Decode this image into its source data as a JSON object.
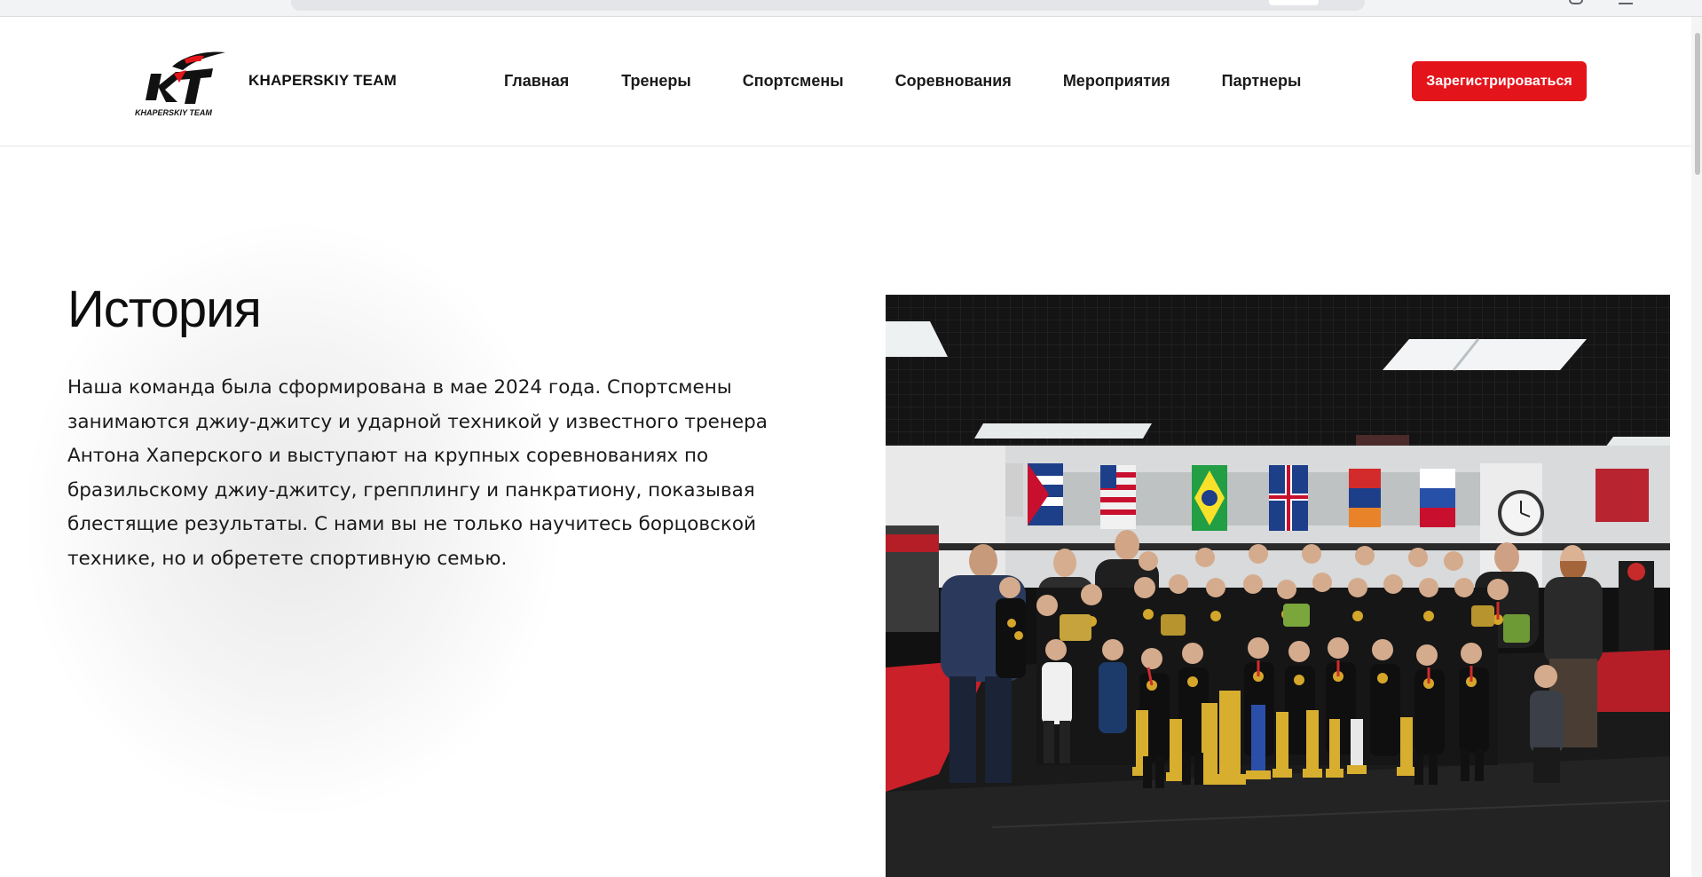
{
  "header": {
    "brand": "KHAPERSKIY TEAM",
    "logo_text": "KHAPERSKIY TEAM",
    "nav": [
      {
        "label": "Главная"
      },
      {
        "label": "Тренеры"
      },
      {
        "label": "Спортсмены"
      },
      {
        "label": "Соревнования"
      },
      {
        "label": "Мероприятия"
      },
      {
        "label": "Партнеры"
      }
    ],
    "cta_label": "Зарегистрироваться"
  },
  "history": {
    "title": "История",
    "lines": [
      "Наша команда была сформирована в мае 2024 года. Спортсмены",
      "занимаются джиу-джитсу и ударной техникой у известного тренера",
      "Антона Хаперского и выступают на крупных соревнованиях по",
      "бразильскому джиу-джитсу, грепплингу и панкратиону, показывая",
      "блестящие результаты. С нами вы не только научитесь борцовской",
      "технике, но и обретете спортивную семью."
    ]
  },
  "colors": {
    "accent": "#e4141b",
    "text": "#111111",
    "mat_red": "#c9202a"
  },
  "icons": {
    "logo": "kt-logo-icon"
  }
}
